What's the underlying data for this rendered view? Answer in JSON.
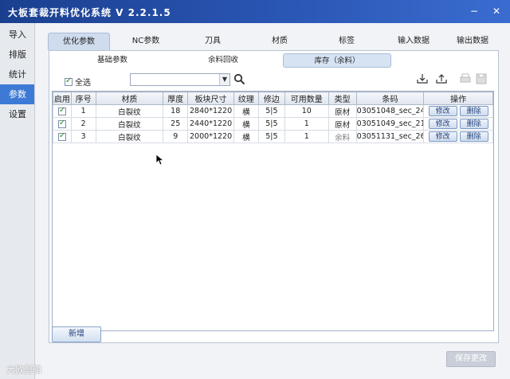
{
  "window": {
    "title": "大板套裁开料优化系统 V 2.2.1.5",
    "minimize": "−",
    "close": "✕"
  },
  "sidebar": {
    "items": [
      {
        "label": "导入"
      },
      {
        "label": "排版"
      },
      {
        "label": "统计"
      },
      {
        "label": "参数"
      },
      {
        "label": "设置"
      }
    ],
    "active_index": 3
  },
  "top_tabs": [
    "优化参数",
    "NC参数",
    "刀具",
    "材质",
    "标签",
    "输入数据",
    "输出数据"
  ],
  "sub_tabs": [
    "基础参数",
    "余料回收",
    "库存（余料）"
  ],
  "toolbar": {
    "select_all_label": "全选",
    "combo_value": "",
    "icons": [
      "import-icon",
      "export-icon",
      "print-icon",
      "save-icon"
    ]
  },
  "table": {
    "headers": [
      "启用",
      "序号",
      "材质",
      "厚度",
      "板块尺寸",
      "纹理",
      "修边",
      "可用数量",
      "类型",
      "条码",
      "操作"
    ],
    "rows": [
      {
        "enabled": true,
        "no": "1",
        "material": "白裂纹",
        "thickness": "18",
        "size": "2840*1220",
        "grain": "横",
        "trim": "5|5",
        "qty": "10",
        "type": "原材",
        "barcode": "03051048_sec_24",
        "edit": "修改",
        "delete": "删除"
      },
      {
        "enabled": true,
        "no": "2",
        "material": "白裂纹",
        "thickness": "25",
        "size": "2440*1220",
        "grain": "横",
        "trim": "5|5",
        "qty": "1",
        "type": "原材",
        "barcode": "03051049_sec_21",
        "edit": "修改",
        "delete": "删除"
      },
      {
        "enabled": true,
        "no": "3",
        "material": "白裂纹",
        "thickness": "9",
        "size": "2000*1220",
        "grain": "横",
        "trim": "5|5",
        "qty": "1",
        "type": "余料",
        "barcode": "03051131_sec_26",
        "edit": "修改",
        "delete": "删除"
      }
    ]
  },
  "buttons": {
    "add": "新增",
    "save": "保存更改"
  },
  "watermark": "大欧剪辑",
  "colors": {
    "titlebar": "#2a56b4",
    "sidebar_active": "#3d7ad6",
    "check": "#2a8a2a"
  }
}
